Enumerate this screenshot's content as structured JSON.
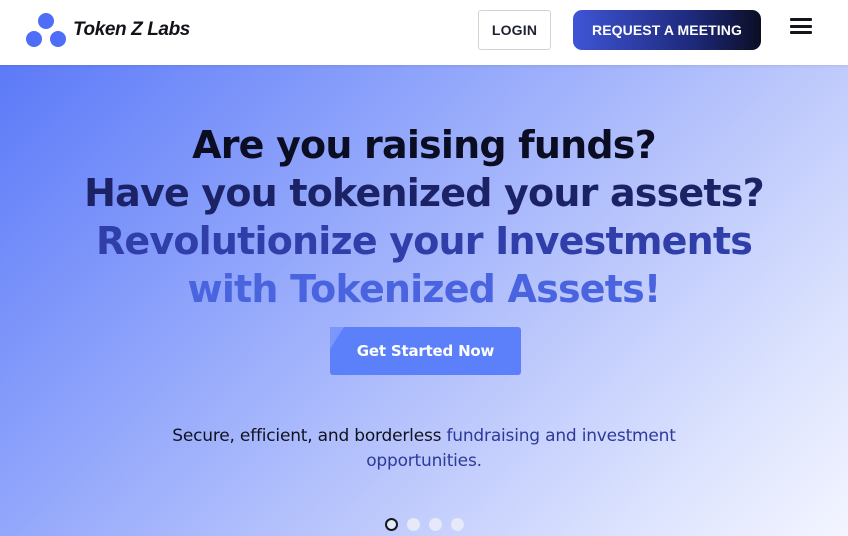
{
  "header": {
    "logo_text": "Token Z Labs",
    "login_label": "LOGIN",
    "meeting_label": "REQUEST A MEETING"
  },
  "hero": {
    "headline": [
      "Are you raising funds?",
      "Have you tokenized your assets?",
      "Revolutionize your Investments",
      "with Tokenized Assets!"
    ],
    "cta_label": "Get Started Now",
    "tagline_part1": "Secure, efficient, and borderless",
    "tagline_part2": "fundraising and investment",
    "tagline_part3": "opportunities.",
    "slide_count": 4,
    "active_slide": 1
  },
  "colors": {
    "brand_blue": "#4f6ef7",
    "meeting_button_start": "#3f55d6",
    "meeting_button_end": "#0b0e25",
    "cta_button": "#5b80fa"
  },
  "icons": {
    "logo": "three-circle-cluster-icon",
    "menu": "hamburger-menu-icon"
  }
}
